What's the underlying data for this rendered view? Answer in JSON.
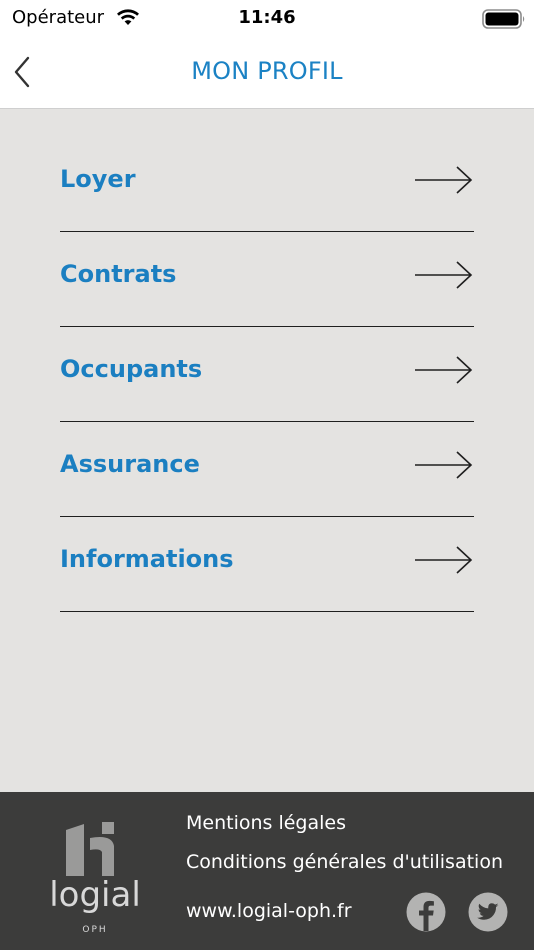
{
  "status_bar": {
    "carrier": "Opérateur",
    "time": "11:46"
  },
  "nav": {
    "title": "MON PROFIL"
  },
  "menu": {
    "items": [
      {
        "label": "Loyer"
      },
      {
        "label": "Contrats"
      },
      {
        "label": "Occupants"
      },
      {
        "label": "Assurance"
      },
      {
        "label": "Informations"
      }
    ]
  },
  "footer": {
    "logo_text": "logial",
    "logo_subtext": "OPH",
    "legal_link": "Mentions légales",
    "cgu_link": "Conditions générales d'utilisation",
    "website_link": "www.logial-oph.fr"
  },
  "icons": {
    "back": "chevron-left-icon",
    "arrow": "arrow-right-icon",
    "facebook": "facebook-icon",
    "twitter": "twitter-icon",
    "wifi": "wifi-icon",
    "battery": "battery-icon"
  },
  "colors": {
    "accent": "#1b82c4",
    "menu_background": "#e4e3e1",
    "footer_background": "#3c3c3b",
    "divider": "#1f1f1f"
  }
}
